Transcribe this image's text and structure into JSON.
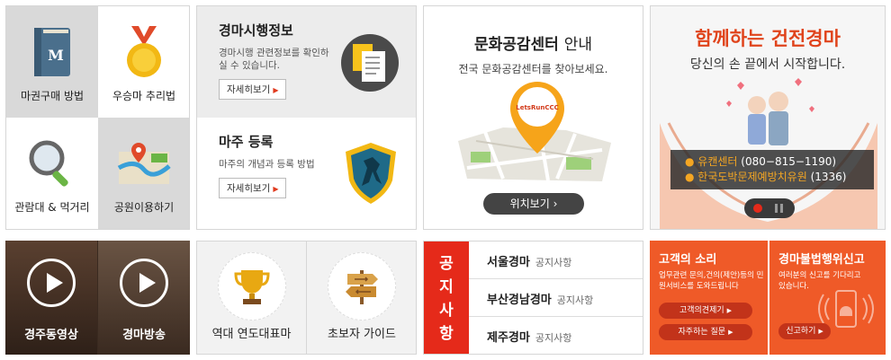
{
  "panel_guides": {
    "items": [
      {
        "label": "마권구매 방법"
      },
      {
        "label": "우승마 추리법"
      },
      {
        "label": "관람대 & 먹거리"
      },
      {
        "label": "공원이용하기"
      }
    ]
  },
  "panel_info": {
    "info1": {
      "title": "경마시행정보",
      "desc": "경마시행 관련정보를 확인하실 수 있습니다.",
      "button": "자세히보기"
    },
    "info2": {
      "title": "마주 등록",
      "desc": "마주의 개념과 등록 방법",
      "button": "자세히보기"
    }
  },
  "panel_culture": {
    "title": "문화공감센터",
    "title_suffix": "안내",
    "desc": "전국 문화공감센터를 찾아보세요.",
    "logo_text": "LetsRunCCC",
    "button": "위치보기"
  },
  "panel_healthy": {
    "title": "함께하는 건전경마",
    "subtitle": "당신의 손 끝에서 시작합니다.",
    "hotline1_name": "유캔센터",
    "hotline1_num": "(080−815−1190)",
    "hotline2_name": "한국도박문제예방치유원",
    "hotline2_num": "(1336)"
  },
  "bottom_videos": {
    "v1": "경주동영상",
    "v2": "경마방송"
  },
  "bottom_menu": {
    "m1": "역대 연도대표마",
    "m2": "초보자 가이드"
  },
  "notice": {
    "tag": "공지사항",
    "rows": [
      {
        "name": "서울경마",
        "type": "공지사항"
      },
      {
        "name": "부산경남경마",
        "type": "공지사항"
      },
      {
        "name": "제주경마",
        "type": "공지사항"
      }
    ]
  },
  "customer": {
    "voice_title": "고객의 소리",
    "voice_desc": "업무관련 문의,건의(제안)등의 민원서비스를 도와드립니다",
    "voice_btn1": "고객의견제기",
    "voice_btn2": "자주하는 질문",
    "illegal_title": "경마불법행위신고",
    "illegal_desc": "여러분의 신고를 기다리고 있습니다.",
    "illegal_btn": "신고하기"
  },
  "colors": {
    "accent": "#e52a1a",
    "orange": "#ef5a28"
  }
}
